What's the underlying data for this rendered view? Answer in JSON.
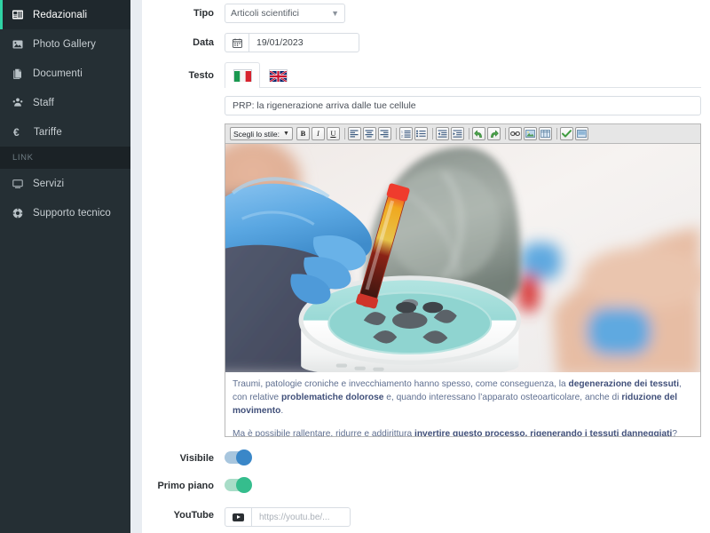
{
  "sidebar": {
    "items": [
      {
        "label": "Redazionali",
        "icon": "newspaper-icon",
        "active": true
      },
      {
        "label": "Photo Gallery",
        "icon": "image-icon",
        "active": false
      },
      {
        "label": "Documenti",
        "icon": "documents-icon",
        "active": false
      },
      {
        "label": "Staff",
        "icon": "people-icon",
        "active": false
      },
      {
        "label": "Tariffe",
        "icon": "euro-icon",
        "active": false
      }
    ],
    "section_label": "LINK",
    "link_items": [
      {
        "label": "Servizi",
        "icon": "monitor-icon"
      },
      {
        "label": "Supporto tecnico",
        "icon": "lifebuoy-icon"
      }
    ],
    "bg_color": "#252f34",
    "active_accent": "#2fd3a5"
  },
  "form": {
    "tipo": {
      "label": "Tipo",
      "value": "Articoli scientifici",
      "caret": "chevron-down"
    },
    "data": {
      "label": "Data",
      "value": "19/01/2023"
    },
    "testo": {
      "label": "Testo",
      "tabs": [
        {
          "name": "italian-flag",
          "active": true
        },
        {
          "name": "uk-flag",
          "active": false
        }
      ],
      "title_value": "PRP: la rigenerazione arriva dalle tue cellule"
    },
    "visibile": {
      "label": "Visibile",
      "state": "on",
      "color": "#3a87c8"
    },
    "primo_piano": {
      "label": "Primo piano",
      "state": "on",
      "color": "#35bd8d"
    },
    "youtube": {
      "label": "YouTube",
      "placeholder": "https://youtu.be/...",
      "value": ""
    }
  },
  "editor": {
    "style_select_label": "Scegli lo stile:",
    "buttons": [
      {
        "name": "bold-icon",
        "label": "B"
      },
      {
        "name": "italic-icon",
        "label": "I"
      },
      {
        "name": "underline-icon",
        "label": "U"
      },
      {
        "name": "align-left-icon",
        "label": ""
      },
      {
        "name": "align-center-icon",
        "label": ""
      },
      {
        "name": "align-right-icon",
        "label": ""
      },
      {
        "name": "ordered-list-icon",
        "label": ""
      },
      {
        "name": "unordered-list-icon",
        "label": ""
      },
      {
        "name": "outdent-icon",
        "label": ""
      },
      {
        "name": "indent-icon",
        "label": ""
      },
      {
        "name": "undo-icon",
        "label": ""
      },
      {
        "name": "redo-icon",
        "label": ""
      },
      {
        "name": "link-icon",
        "label": ""
      },
      {
        "name": "insert-image-icon",
        "label": ""
      },
      {
        "name": "insert-table-icon",
        "label": ""
      },
      {
        "name": "spellcheck-icon",
        "label": ""
      },
      {
        "name": "media-icon",
        "label": ""
      }
    ],
    "image_alt": "Operatore sanitario con guanti blu inserisce una provetta di sangue in una centrifuga da laboratorio",
    "paragraphs": [
      {
        "runs": [
          {
            "t": "Traumi, patologie croniche e invecchiamento hanno spesso, come conseguenza, la ",
            "b": false
          },
          {
            "t": "degenerazione dei tessuti",
            "b": true
          },
          {
            "t": ", con relative ",
            "b": false
          },
          {
            "t": "problematiche dolorose",
            "b": true
          },
          {
            "t": " e, quando interessano l’apparato osteoarticolare, anche di ",
            "b": false
          },
          {
            "t": "riduzione del movimento",
            "b": true
          },
          {
            "t": ".",
            "b": false
          }
        ]
      },
      {
        "runs": [
          {
            "t": "Ma è possibile rallentare, ridurre e addirittura ",
            "b": false
          },
          {
            "t": "invertire questo processo, rigenerando i tessuti danneggiati",
            "b": true
          },
          {
            "t": "?",
            "b": false
          }
        ]
      }
    ]
  }
}
